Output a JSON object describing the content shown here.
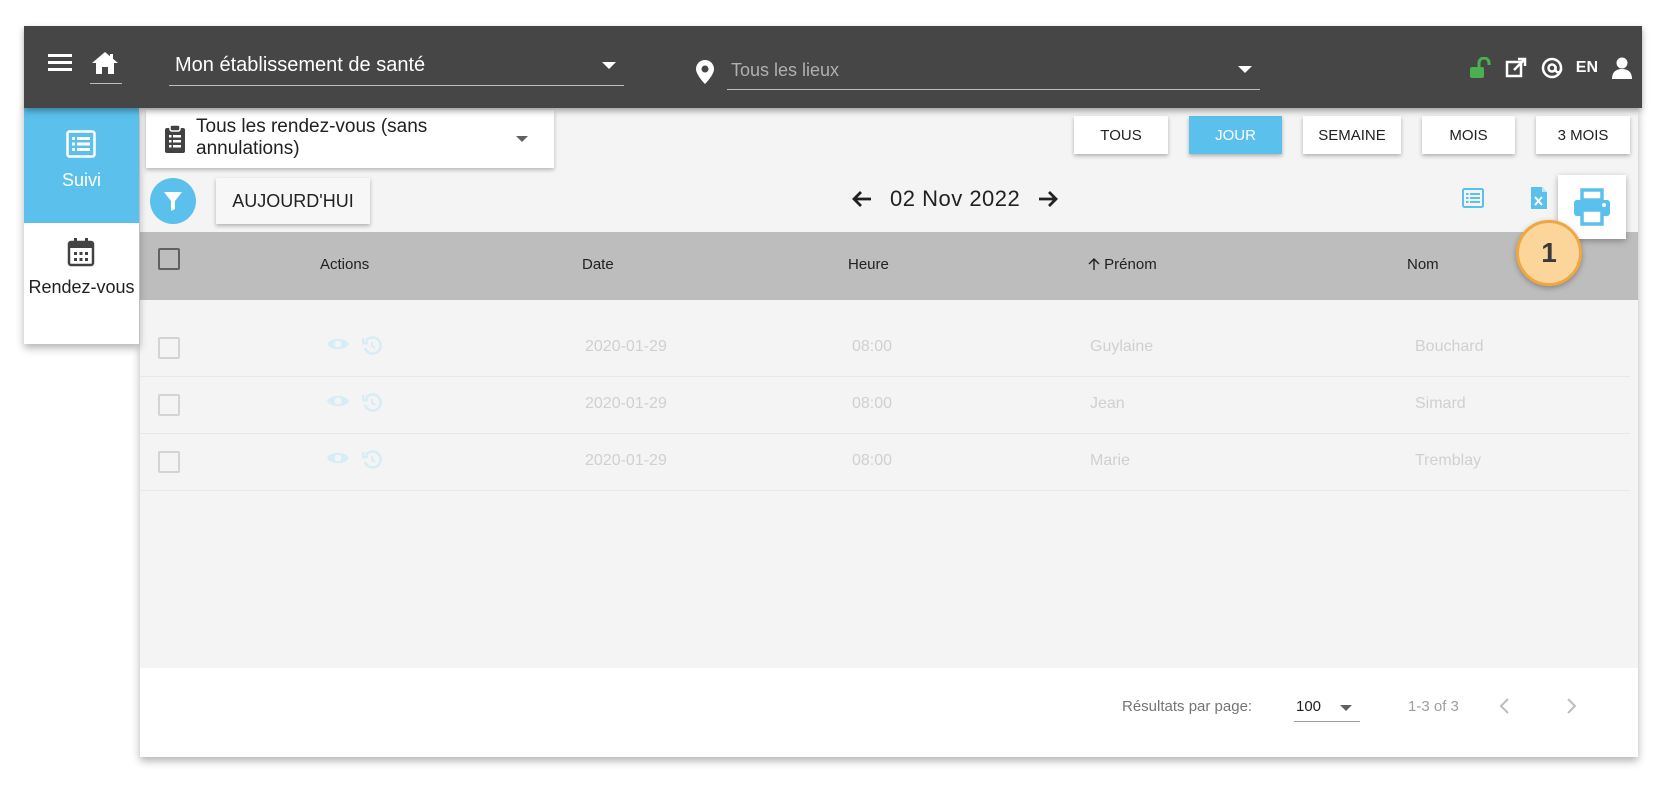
{
  "topbar": {
    "establishment": "Mon établissement de santé",
    "location_placeholder": "Tous les lieux",
    "language": "EN"
  },
  "nav": {
    "suivi": "Suivi",
    "rendezvous": "Rendez-vous"
  },
  "filter": {
    "appointment_filter": "Tous les rendez-vous (sans annulations)"
  },
  "view_buttons": [
    "TOUS",
    "JOUR",
    "SEMAINE",
    "MOIS",
    "3 MOIS"
  ],
  "active_view": "JOUR",
  "toolbar": {
    "today_label": "AUJOURD'HUI",
    "current_date": "02 Nov 2022",
    "step_badge": "1"
  },
  "table": {
    "columns": [
      "Actions",
      "Date",
      "Heure",
      "Prénom",
      "Nom"
    ],
    "sort_column": "Prénom",
    "rows": [
      {
        "date": "2020-01-29",
        "heure": "08:00",
        "prenom": "Guylaine",
        "nom": "Bouchard"
      },
      {
        "date": "2020-01-29",
        "heure": "08:00",
        "prenom": "Jean",
        "nom": "Simard"
      },
      {
        "date": "2020-01-29",
        "heure": "08:00",
        "prenom": "Marie",
        "nom": "Tremblay"
      }
    ]
  },
  "pagination": {
    "results_per_page_label": "Résultats par page:",
    "results_per_page": "100",
    "range": "1-3 of 3"
  },
  "colors": {
    "topbar": "#464646",
    "accent": "#5bc0eb",
    "badge_fill": "#fbd59a",
    "badge_border": "#f0a741",
    "lock_green": "#4caf50"
  }
}
